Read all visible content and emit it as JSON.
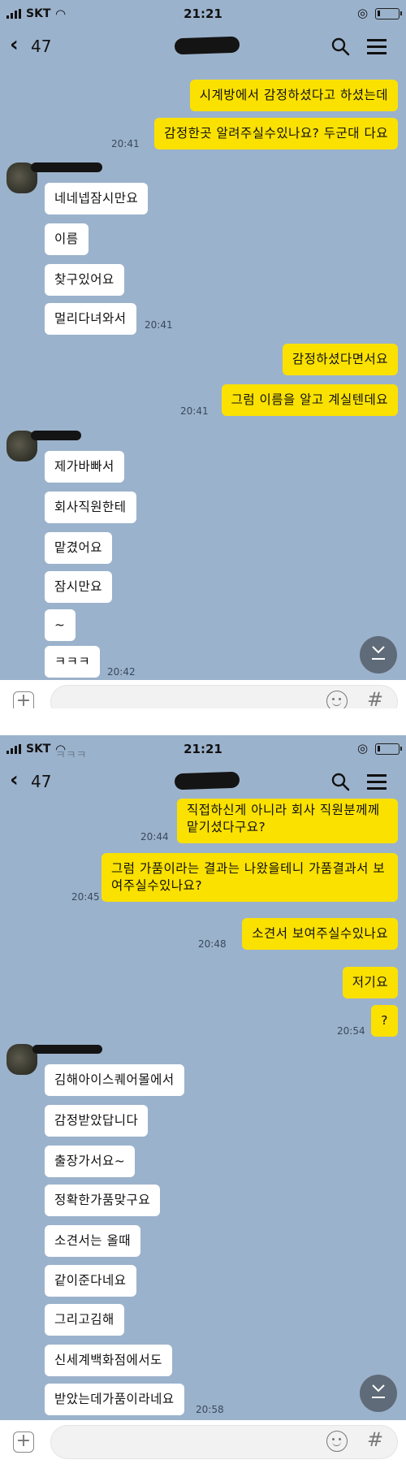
{
  "status_bar": {
    "carrier": "SKT",
    "time": "21:21",
    "battery_level": 0.15
  },
  "header": {
    "back_count": "47"
  },
  "screen1": {
    "messages": [
      {
        "sender": "me",
        "text": "시계방에서 감정하셨다고 하셨는데"
      },
      {
        "sender": "me",
        "text": "감정한곳 알려주실수있나요? 두군대 다요",
        "time": "20:41"
      },
      {
        "sender": "them",
        "text": "네네넵잠시만요"
      },
      {
        "sender": "them",
        "text": "이름"
      },
      {
        "sender": "them",
        "text": "찾구있어요"
      },
      {
        "sender": "them",
        "text": "멀리다녀와서",
        "time": "20:41"
      },
      {
        "sender": "me",
        "text": "감정하셨다면서요"
      },
      {
        "sender": "me",
        "text": "그럼 이름을 알고 계실텐데요",
        "time": "20:41"
      },
      {
        "sender": "them",
        "text": "제가바빠서"
      },
      {
        "sender": "them",
        "text": "회사직원한테"
      },
      {
        "sender": "them",
        "text": "맡겼어요"
      },
      {
        "sender": "them",
        "text": "잠시만요"
      },
      {
        "sender": "them",
        "text": "~"
      },
      {
        "sender": "them",
        "text": "ㅋㅋㅋ",
        "time": "20:42"
      }
    ]
  },
  "screen2": {
    "top_partial": "ㅋㅋㅋ",
    "messages": [
      {
        "sender": "me",
        "text": "직접하신게 아니라 회사 직원분께께 맡기셨다구요?",
        "time": "20:44"
      },
      {
        "sender": "me",
        "text": "그럼 가품이라는 결과는 나왔을테니 가품결과서 보여주실수있나요?",
        "time": "20:45"
      },
      {
        "sender": "me",
        "text": "소견서 보여주실수있나요",
        "time": "20:48"
      },
      {
        "sender": "me",
        "text": "저기요"
      },
      {
        "sender": "me",
        "text": "?",
        "time": "20:54"
      },
      {
        "sender": "them",
        "text": "김해아이스퀘어몰에서"
      },
      {
        "sender": "them",
        "text": "감정받았답니다"
      },
      {
        "sender": "them",
        "text": "출장가서요~"
      },
      {
        "sender": "them",
        "text": "정확한가품맞구요"
      },
      {
        "sender": "them",
        "text": "소견서는 올때"
      },
      {
        "sender": "them",
        "text": "같이준다네요"
      },
      {
        "sender": "them",
        "text": "그리고김해"
      },
      {
        "sender": "them",
        "text": "신세계백화점에서도"
      },
      {
        "sender": "them",
        "text": "받았는데가품이라네요",
        "time": "20:58"
      }
    ]
  },
  "input_bar": {
    "hash_symbol": "#"
  },
  "colors": {
    "chat_background": "#9bb2cc",
    "my_bubble": "#fae100",
    "their_bubble": "#ffffff"
  },
  "icons": [
    "back-chevron-icon",
    "search-icon",
    "menu-icon",
    "plus-icon",
    "emoji-icon",
    "hash-icon",
    "scroll-down-icon",
    "wifi-icon",
    "signal-icon",
    "lock-rotation-icon",
    "battery-icon"
  ]
}
